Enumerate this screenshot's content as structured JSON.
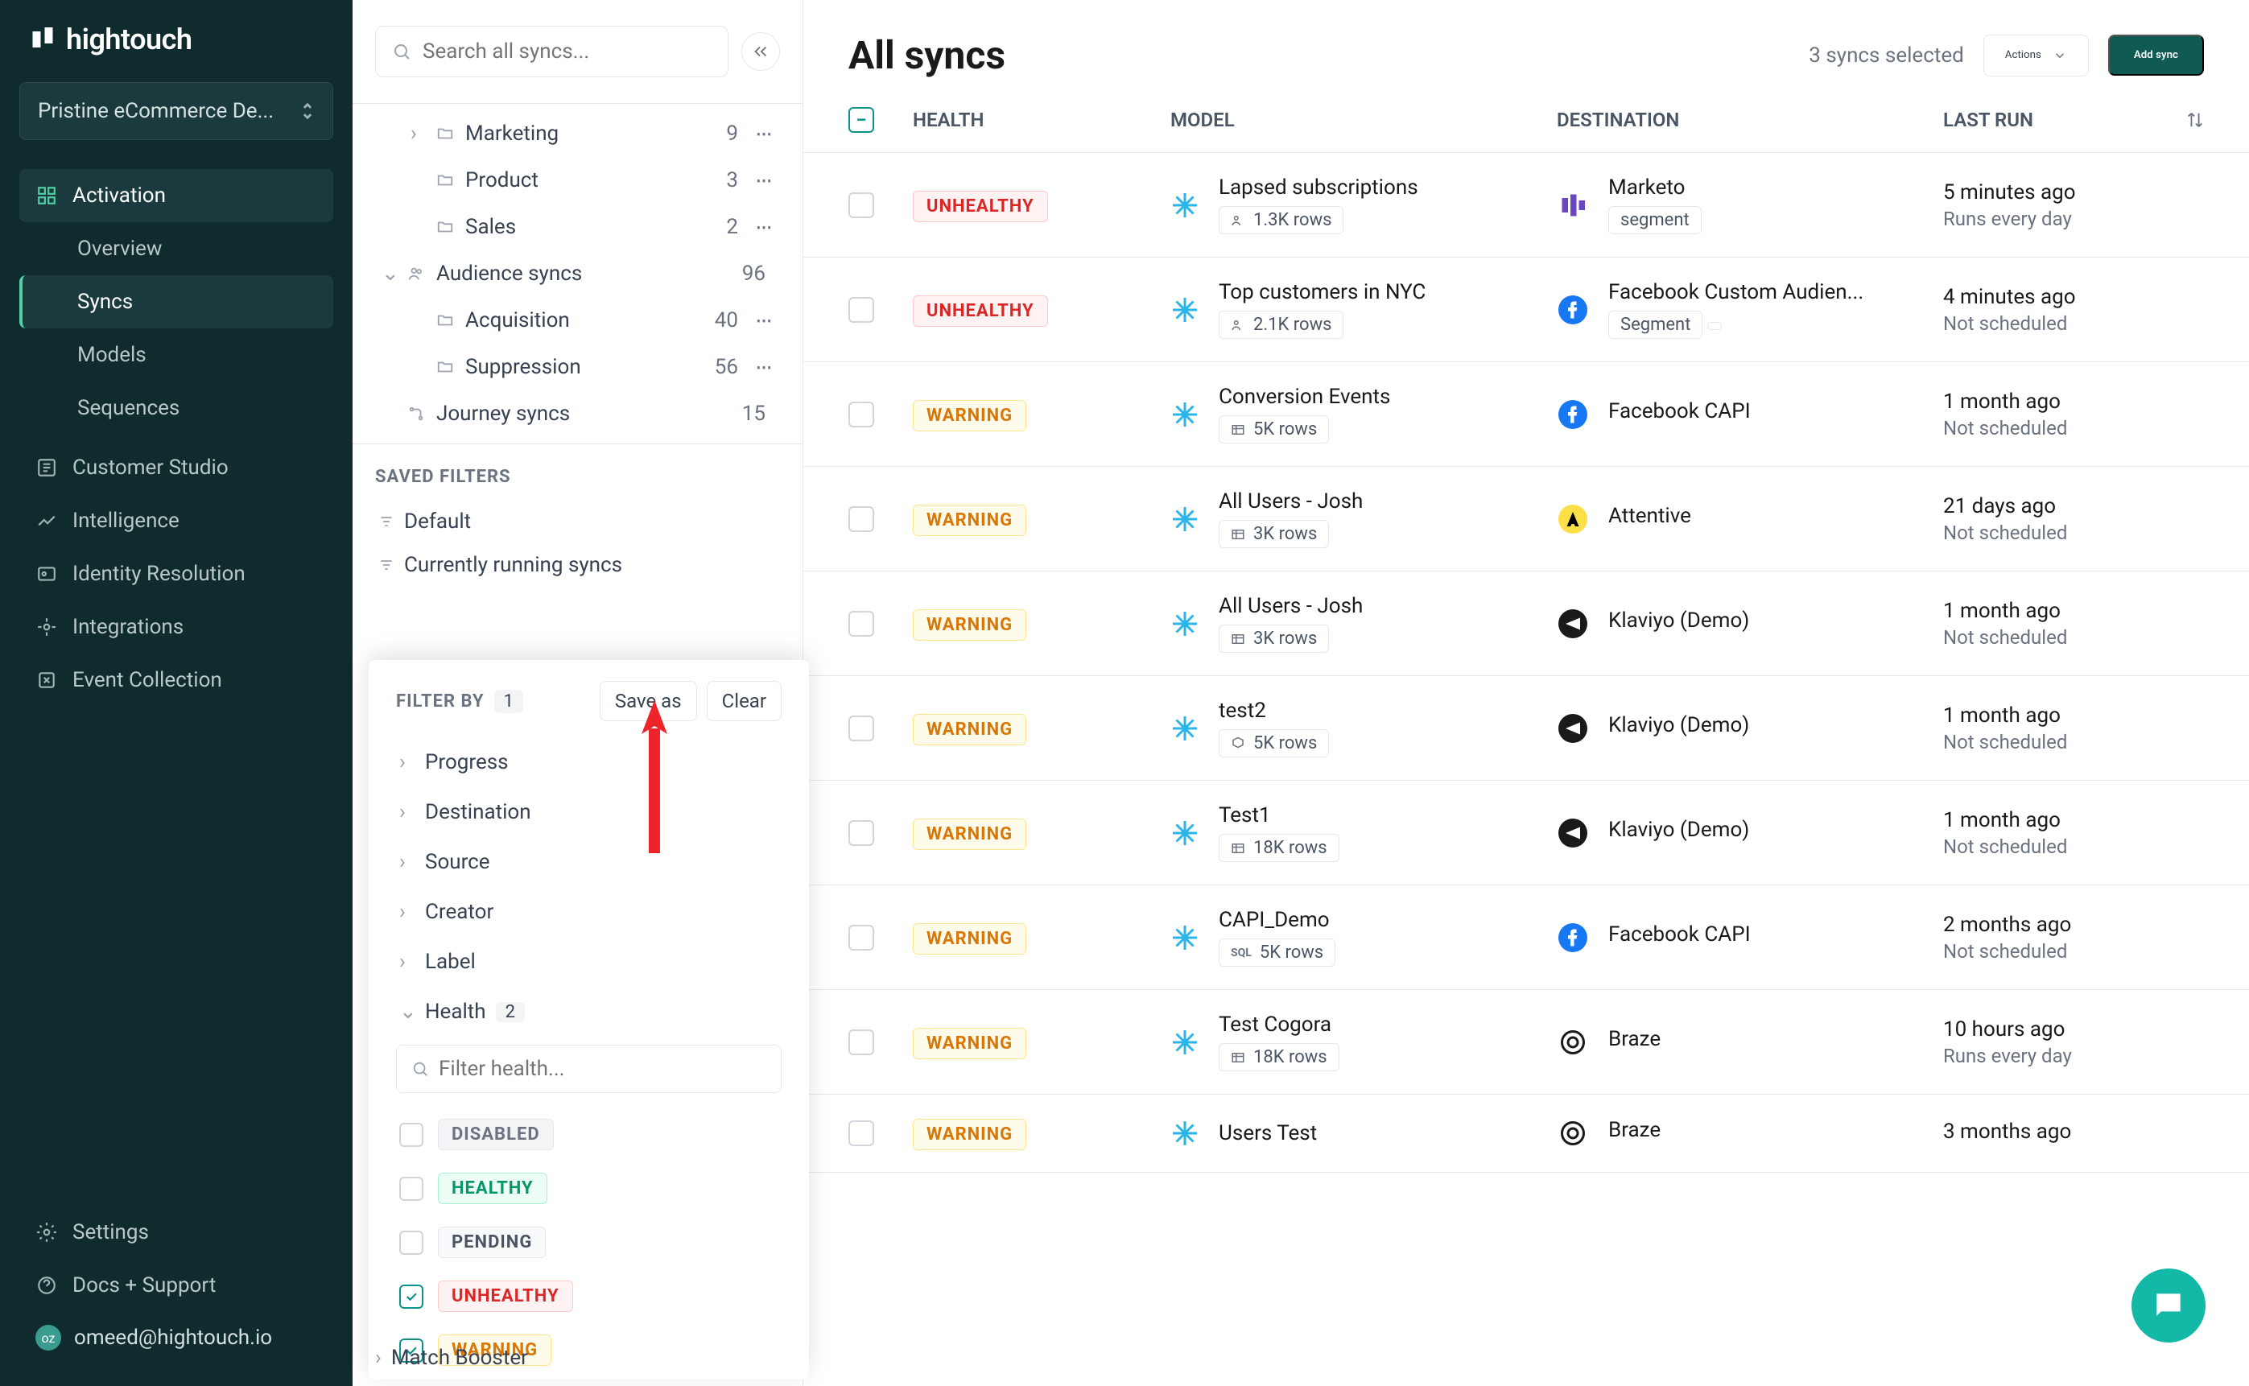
{
  "brand": "hightouch",
  "workspace": "Pristine eCommerce De...",
  "nav": {
    "activation": "Activation",
    "overview": "Overview",
    "syncs": "Syncs",
    "models": "Models",
    "sequences": "Sequences",
    "customer_studio": "Customer Studio",
    "intelligence": "Intelligence",
    "identity": "Identity Resolution",
    "integrations": "Integrations",
    "events": "Event Collection",
    "settings": "Settings",
    "docs": "Docs + Support",
    "user": "omeed@hightouch.io",
    "avatar": "oz"
  },
  "panel": {
    "search_placeholder": "Search all syncs...",
    "tree": [
      {
        "label": "Marketing",
        "count": "9",
        "indent": 1,
        "chev": "›",
        "dots": true
      },
      {
        "label": "Product",
        "count": "3",
        "indent": 1,
        "chev": "",
        "dots": true
      },
      {
        "label": "Sales",
        "count": "2",
        "indent": 1,
        "chev": "",
        "dots": true
      },
      {
        "label": "Audience syncs",
        "count": "96",
        "indent": 0,
        "chev": "⌄",
        "icon": "people"
      },
      {
        "label": "Acquisition",
        "count": "40",
        "indent": 1,
        "chev": "",
        "dots": true
      },
      {
        "label": "Suppression",
        "count": "56",
        "indent": 1,
        "chev": "",
        "dots": true
      },
      {
        "label": "Journey syncs",
        "count": "15",
        "indent": 0,
        "chev": "",
        "icon": "journey"
      }
    ],
    "saved_filters_title": "SAVED FILTERS",
    "saved": [
      "Default",
      "Currently running syncs"
    ]
  },
  "filter": {
    "title": "FILTER BY",
    "count": "1",
    "save_as": "Save as",
    "clear": "Clear",
    "groups": [
      {
        "label": "Progress"
      },
      {
        "label": "Destination"
      },
      {
        "label": "Source"
      },
      {
        "label": "Creator"
      },
      {
        "label": "Label"
      }
    ],
    "health_label": "Health",
    "health_count": "2",
    "health_search_placeholder": "Filter health...",
    "options": [
      {
        "label": "DISABLED",
        "cls": "pill-disabled",
        "checked": false
      },
      {
        "label": "HEALTHY",
        "cls": "pill-healthy",
        "checked": false
      },
      {
        "label": "PENDING",
        "cls": "pill-pending",
        "checked": false
      },
      {
        "label": "UNHEALTHY",
        "cls": "pill-unhealthy",
        "checked": true
      },
      {
        "label": "WARNING",
        "cls": "pill-warning",
        "checked": true
      }
    ],
    "match_booster": "Match Booster"
  },
  "main": {
    "title": "All syncs",
    "selected": "3 syncs selected",
    "actions": "Actions",
    "add": "Add sync",
    "cols": {
      "health": "HEALTH",
      "model": "MODEL",
      "dest": "DESTINATION",
      "last": "LAST RUN"
    },
    "rows": [
      {
        "health": "UNHEALTHY",
        "hcls": "pill-unhealthy",
        "model": "Lapsed subscriptions",
        "rows": "1.3K rows",
        "rowicon": "people",
        "dest": "Marketo",
        "dtag": "segment",
        "dicon": "marketo",
        "last": "5 minutes ago",
        "sched": "Runs every day"
      },
      {
        "health": "UNHEALTHY",
        "hcls": "pill-unhealthy",
        "model": "Top customers in NYC",
        "rows": "2.1K rows",
        "rowicon": "people",
        "dest": "Facebook Custom Audien...",
        "dtag": "Segment",
        "dicon": "facebook",
        "last": "4 minutes ago",
        "sched": "Not scheduled",
        "dtag2": true
      },
      {
        "health": "WARNING",
        "hcls": "pill-warning",
        "model": "Conversion Events",
        "rows": "5K rows",
        "rowicon": "table",
        "dest": "Facebook CAPI",
        "dicon": "facebook",
        "last": "1 month ago",
        "sched": "Not scheduled"
      },
      {
        "health": "WARNING",
        "hcls": "pill-warning",
        "model": "All Users - Josh",
        "rows": "3K rows",
        "rowicon": "table",
        "dest": "Attentive",
        "dicon": "attentive",
        "last": "21 days ago",
        "sched": "Not scheduled"
      },
      {
        "health": "WARNING",
        "hcls": "pill-warning",
        "model": "All Users - Josh",
        "rows": "3K rows",
        "rowicon": "table",
        "dest": "Klaviyo (Demo)",
        "dicon": "klaviyo",
        "last": "1 month ago",
        "sched": "Not scheduled"
      },
      {
        "health": "WARNING",
        "hcls": "pill-warning",
        "model": "test2",
        "rows": "5K rows",
        "rowicon": "cube",
        "dest": "Klaviyo (Demo)",
        "dicon": "klaviyo",
        "last": "1 month ago",
        "sched": "Not scheduled"
      },
      {
        "health": "WARNING",
        "hcls": "pill-warning",
        "model": "Test1",
        "rows": "18K rows",
        "rowicon": "table",
        "dest": "Klaviyo (Demo)",
        "dicon": "klaviyo",
        "last": "1 month ago",
        "sched": "Not scheduled"
      },
      {
        "health": "WARNING",
        "hcls": "pill-warning",
        "model": "CAPI_Demo",
        "rows": "5K rows",
        "rowicon": "sql",
        "dest": "Facebook CAPI",
        "dicon": "facebook",
        "last": "2 months ago",
        "sched": "Not scheduled"
      },
      {
        "health": "WARNING",
        "hcls": "pill-warning",
        "model": "Test Cogora",
        "rows": "18K rows",
        "rowicon": "table",
        "dest": "Braze",
        "dicon": "braze",
        "last": "10 hours ago",
        "sched": "Runs every day"
      },
      {
        "health": "WARNING",
        "hcls": "pill-warning",
        "model": "Users Test",
        "rows": "",
        "rowicon": "table",
        "dest": "Braze",
        "dicon": "braze",
        "last": "3 months ago",
        "sched": ""
      }
    ]
  }
}
